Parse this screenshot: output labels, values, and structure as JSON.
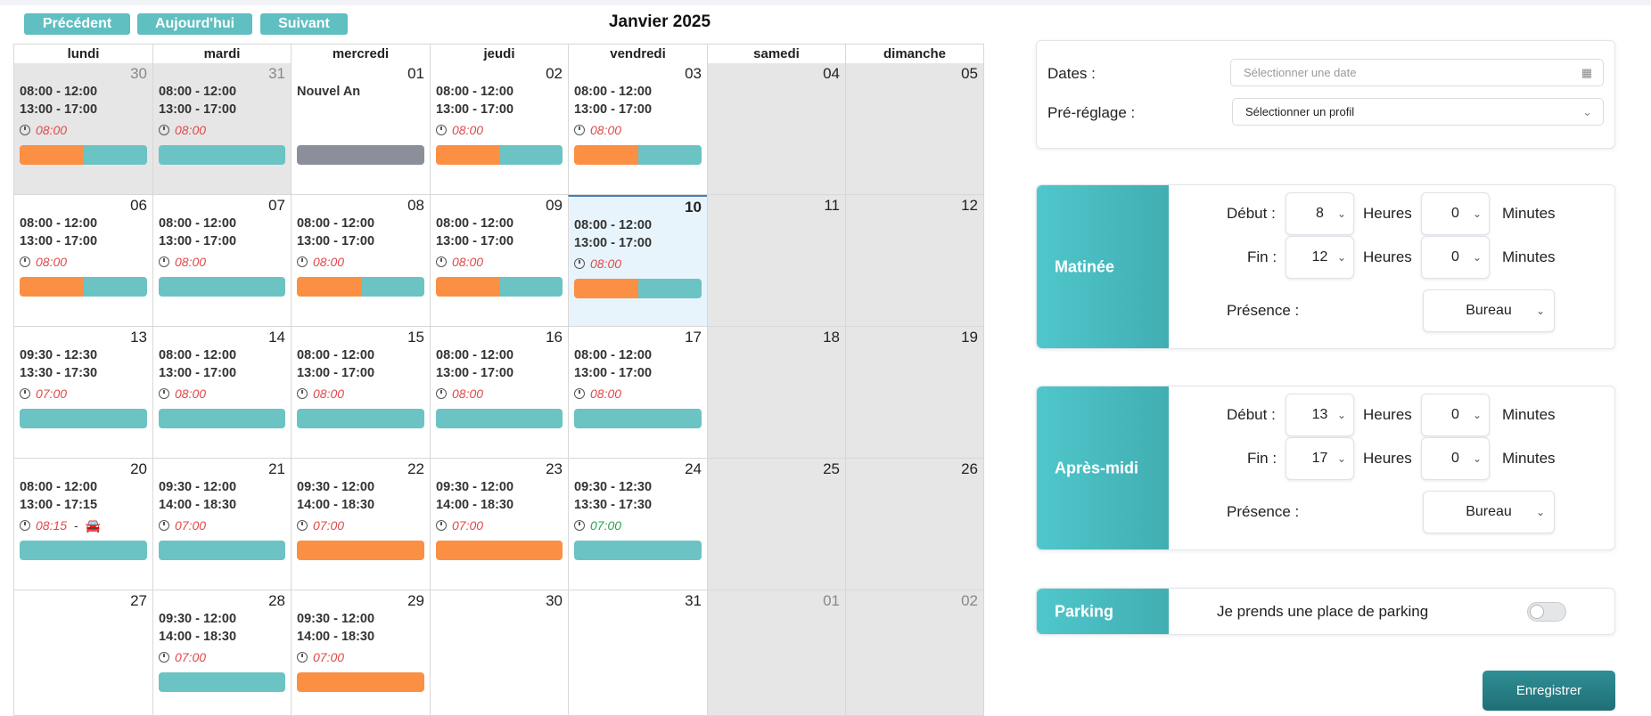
{
  "toolbar": {
    "prev_label": "Précédent",
    "today_label": "Aujourd'hui",
    "next_label": "Suivant",
    "month_title": "Janvier 2025"
  },
  "calendar": {
    "weekdays": [
      "lundi",
      "mardi",
      "mercredi",
      "jeudi",
      "vendredi",
      "samedi",
      "dimanche"
    ],
    "weeks": [
      [
        {
          "day": "30",
          "other": true,
          "grey": true,
          "l1": "08:00 - 12:00",
          "l2": "13:00 - 17:00",
          "arrival": "08:00",
          "bar": "orange-teal"
        },
        {
          "day": "31",
          "other": true,
          "grey": true,
          "l1": "08:00 - 12:00",
          "l2": "13:00 - 17:00",
          "arrival": "08:00",
          "bar": "teal"
        },
        {
          "day": "01",
          "l1": "Nouvel An",
          "bar": "gray"
        },
        {
          "day": "02",
          "l1": "08:00 - 12:00",
          "l2": "13:00 - 17:00",
          "arrival": "08:00",
          "bar": "orange-teal"
        },
        {
          "day": "03",
          "l1": "08:00 - 12:00",
          "l2": "13:00 - 17:00",
          "arrival": "08:00",
          "bar": "orange-teal"
        },
        {
          "day": "04",
          "grey": true
        },
        {
          "day": "05",
          "grey": true
        }
      ],
      [
        {
          "day": "06",
          "l1": "08:00 - 12:00",
          "l2": "13:00 - 17:00",
          "arrival": "08:00",
          "bar": "orange-teal"
        },
        {
          "day": "07",
          "l1": "08:00 - 12:00",
          "l2": "13:00 - 17:00",
          "arrival": "08:00",
          "bar": "teal"
        },
        {
          "day": "08",
          "l1": "08:00 - 12:00",
          "l2": "13:00 - 17:00",
          "arrival": "08:00",
          "bar": "orange-teal"
        },
        {
          "day": "09",
          "l1": "08:00 - 12:00",
          "l2": "13:00 - 17:00",
          "arrival": "08:00",
          "bar": "orange-teal"
        },
        {
          "day": "10",
          "today": true,
          "l1": "08:00 - 12:00",
          "l2": "13:00 - 17:00",
          "arrival": "08:00",
          "bar": "orange-teal"
        },
        {
          "day": "11",
          "grey": true
        },
        {
          "day": "12",
          "grey": true
        }
      ],
      [
        {
          "day": "13",
          "l1": "09:30 - 12:30",
          "l2": "13:30 - 17:30",
          "arrival": "07:00",
          "bar": "teal"
        },
        {
          "day": "14",
          "l1": "08:00 - 12:00",
          "l2": "13:00 - 17:00",
          "arrival": "08:00",
          "bar": "teal"
        },
        {
          "day": "15",
          "l1": "08:00 - 12:00",
          "l2": "13:00 - 17:00",
          "arrival": "08:00",
          "bar": "teal"
        },
        {
          "day": "16",
          "l1": "08:00 - 12:00",
          "l2": "13:00 - 17:00",
          "arrival": "08:00",
          "bar": "teal"
        },
        {
          "day": "17",
          "l1": "08:00 - 12:00",
          "l2": "13:00 - 17:00",
          "arrival": "08:00",
          "bar": "teal"
        },
        {
          "day": "18",
          "grey": true
        },
        {
          "day": "19",
          "grey": true
        }
      ],
      [
        {
          "day": "20",
          "l1": "08:00 - 12:00",
          "l2": "13:00 - 17:15",
          "arrival": "08:15",
          "car": true,
          "bar": "teal"
        },
        {
          "day": "21",
          "l1": "09:30 - 12:00",
          "l2": "14:00 - 18:30",
          "arrival": "07:00",
          "bar": "teal"
        },
        {
          "day": "22",
          "l1": "09:30 - 12:00",
          "l2": "14:00 - 18:30",
          "arrival": "07:00",
          "bar": "orange"
        },
        {
          "day": "23",
          "l1": "09:30 - 12:00",
          "l2": "14:00 - 18:30",
          "arrival": "07:00",
          "bar": "orange"
        },
        {
          "day": "24",
          "l1": "09:30 - 12:30",
          "l2": "13:30 - 17:30",
          "arrival": "07:00",
          "arrival_green": true,
          "bar": "teal"
        },
        {
          "day": "25",
          "grey": true
        },
        {
          "day": "26",
          "grey": true
        }
      ],
      [
        {
          "day": "27"
        },
        {
          "day": "28",
          "l1": "09:30 - 12:00",
          "l2": "14:00 - 18:30",
          "arrival": "07:00",
          "bar": "teal"
        },
        {
          "day": "29",
          "l1": "09:30 - 12:00",
          "l2": "14:00 - 18:30",
          "arrival": "07:00",
          "bar": "orange"
        },
        {
          "day": "30"
        },
        {
          "day": "31"
        },
        {
          "day": "01",
          "other": true,
          "grey": true
        },
        {
          "day": "02",
          "other": true,
          "grey": true
        }
      ]
    ],
    "car_separator": "-",
    "car_icon": "🚘"
  },
  "colors": {
    "orange": "#fb8f44",
    "teal": "#6cc3c4",
    "gray": "#8a8f99",
    "accent": "#4fc7cc"
  },
  "filters": {
    "dates_label": "Dates :",
    "dates_placeholder": "Sélectionner une date",
    "preset_label": "Pré-réglage :",
    "preset_value": "Sélectionner un profil"
  },
  "morning": {
    "title": "Matinée",
    "start_label": "Début :",
    "start_hours": "8",
    "start_minutes": "0",
    "end_label": "Fin :",
    "end_hours": "12",
    "end_minutes": "0",
    "hours_unit": "Heures",
    "minutes_unit": "Minutes",
    "presence_label": "Présence :",
    "presence_value": "Bureau"
  },
  "afternoon": {
    "title": "Après-midi",
    "start_label": "Début :",
    "start_hours": "13",
    "start_minutes": "0",
    "end_label": "Fin :",
    "end_hours": "17",
    "end_minutes": "0",
    "hours_unit": "Heures",
    "minutes_unit": "Minutes",
    "presence_label": "Présence :",
    "presence_value": "Bureau"
  },
  "parking": {
    "title": "Parking",
    "label": "Je prends une place de parking",
    "enabled": false
  },
  "save_label": "Enregistrer"
}
